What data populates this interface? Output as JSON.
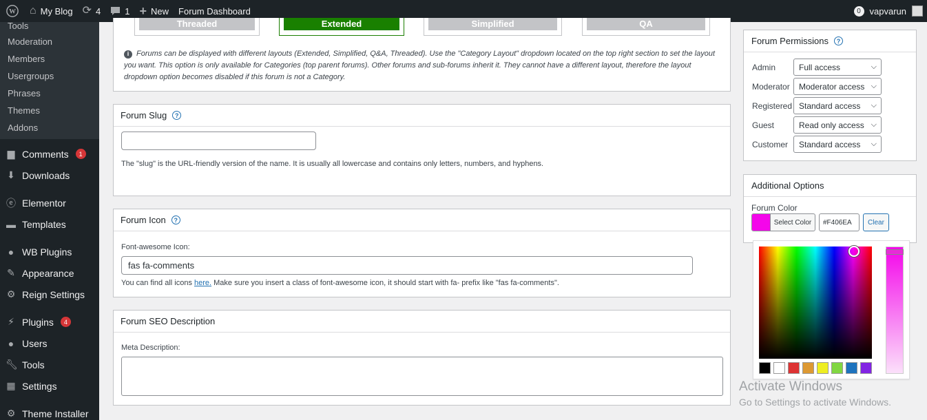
{
  "adminbar": {
    "site_name": "My Blog",
    "updates_count": "4",
    "comments_count": "1",
    "new_label": "New",
    "forum_dashboard_label": "Forum Dashboard",
    "notification_count": "0",
    "username": "vapvarun"
  },
  "sidebar": {
    "submenu": [
      "Tools",
      "Moderation",
      "Members",
      "Usergroups",
      "Phrases",
      "Themes",
      "Addons"
    ],
    "comments_label": "Comments",
    "comments_badge": "1",
    "downloads_label": "Downloads",
    "elementor_label": "Elementor",
    "templates_label": "Templates",
    "wbplugins_label": "WB Plugins",
    "appearance_label": "Appearance",
    "reign_label": "Reign Settings",
    "plugins_label": "Plugins",
    "plugins_badge": "4",
    "users_label": "Users",
    "tools_label": "Tools",
    "settings_label": "Settings",
    "theme_installer_label": "Theme Installer"
  },
  "layout": {
    "tabs": [
      "Threaded",
      "Extended",
      "Simplified",
      "QA"
    ],
    "active_tab": "Extended",
    "note": "Forums can be displayed with different layouts (Extended, Simplified, Q&A, Threaded). Use the \"Category Layout\" dropdown located on the top right section to set the layout you want. This option is only available for Categories (top parent forums). Other forums and sub-forums inherit it. They cannot have a different layout, therefore the layout dropdown option becomes disabled if this forum is not a Category."
  },
  "slug": {
    "title": "Forum Slug",
    "value": "",
    "description": "The \"slug\" is the URL-friendly version of the name. It is usually all lowercase and contains only letters, numbers, and hyphens."
  },
  "icon": {
    "title": "Forum Icon",
    "field_label": "Font-awesome Icon:",
    "value": "fas fa-comments",
    "desc_before": "You can find all icons ",
    "desc_link": "here.",
    "desc_after": " Make sure you insert a class of font-awesome icon, it should start with fa- prefix like \"fas fa-comments\"."
  },
  "seo": {
    "title": "Forum SEO Description",
    "field_label": "Meta Description:",
    "value": ""
  },
  "permissions": {
    "title": "Forum Permissions",
    "rows": [
      {
        "role": "Admin",
        "value": "Full access"
      },
      {
        "role": "Moderator",
        "value": "Moderator access"
      },
      {
        "role": "Registered",
        "value": "Standard access"
      },
      {
        "role": "Guest",
        "value": "Read only access"
      },
      {
        "role": "Customer",
        "value": "Standard access"
      }
    ]
  },
  "additional": {
    "title": "Additional Options",
    "color_label": "Forum Color",
    "select_color_label": "Select Color",
    "color_value": "#F406EA",
    "clear_label": "Clear",
    "swatches": [
      "#000000",
      "#ffffff",
      "#dd3333",
      "#dd9933",
      "#eeee22",
      "#81d742",
      "#1e73be",
      "#8224e3"
    ]
  },
  "watermark": {
    "line1": "Activate Windows",
    "line2": "Go to Settings to activate Windows."
  }
}
